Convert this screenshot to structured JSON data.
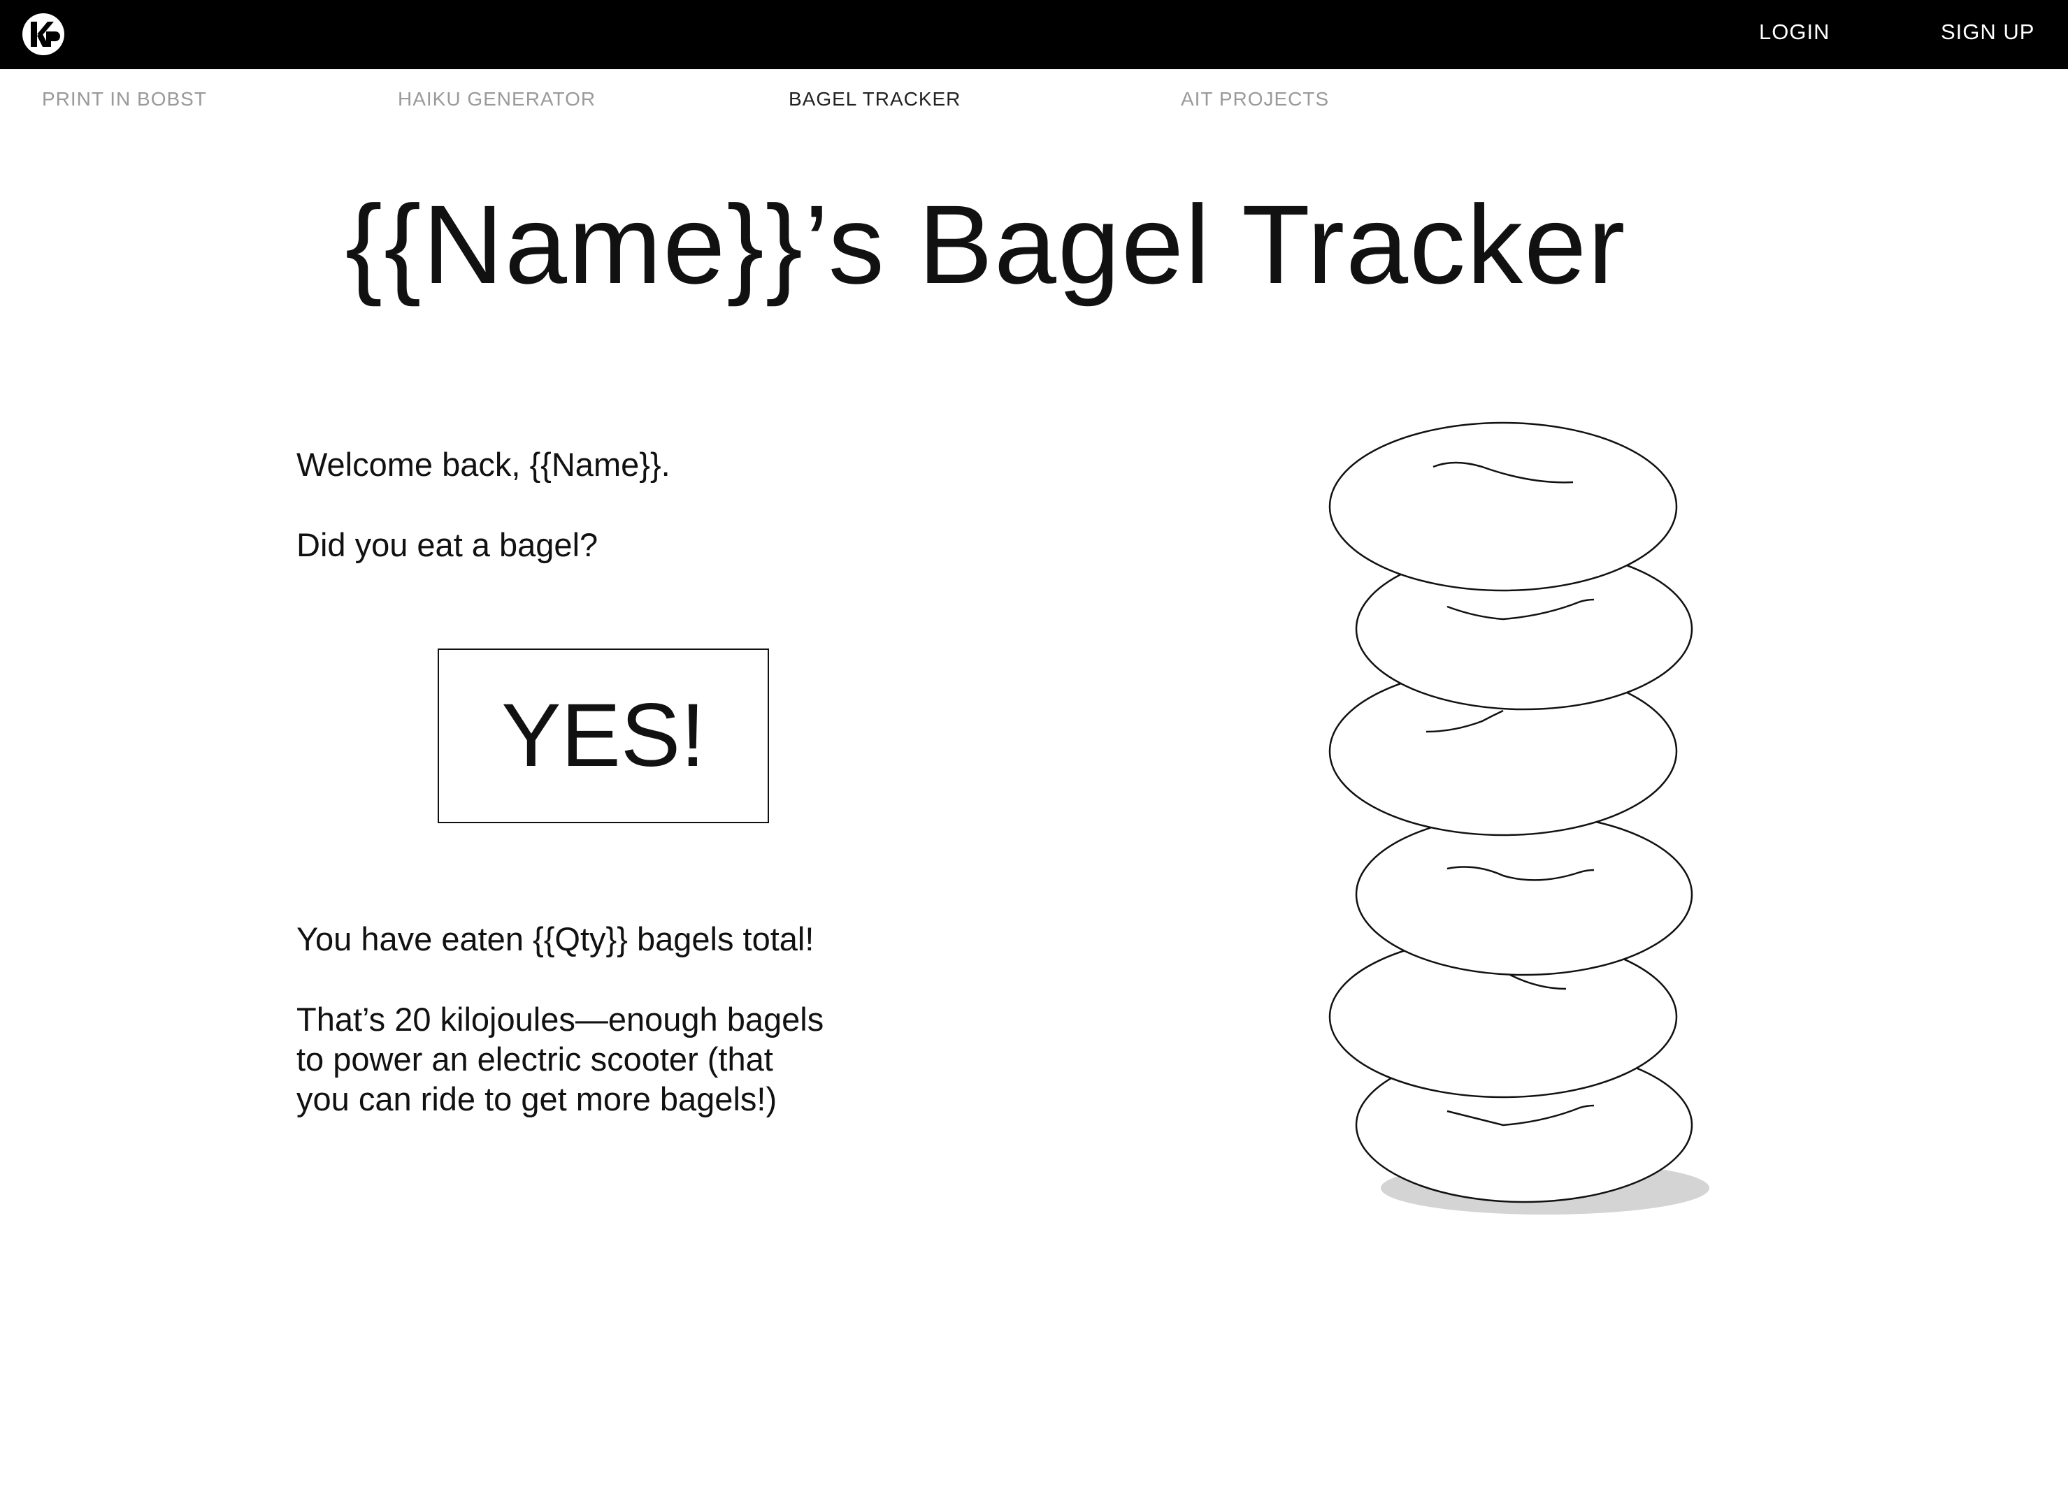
{
  "header": {
    "logo_icon": "kp-logo-icon",
    "login_label": "LOGIN",
    "signup_label": "SIGN UP"
  },
  "nav": {
    "items": [
      {
        "label": "PRINT IN BOBST",
        "active": false
      },
      {
        "label": "HAIKU GENERATOR",
        "active": false
      },
      {
        "label": "BAGEL TRACKER",
        "active": true
      },
      {
        "label": "AIT PROJECTS",
        "active": false
      }
    ]
  },
  "main": {
    "title": "{{Name}}’s Bagel Tracker",
    "welcome": "Welcome back, {{Name}}.",
    "question": "Did you eat a bagel?",
    "yes_button": "YES!",
    "total_text": "You have eaten {{Qty}} bagels total!",
    "energy_line1": "That’s 20 kilojoules—enough bagels",
    "energy_line2": "to power an electric scooter (that",
    "energy_line3": "you can ride to get more bagels!)"
  },
  "illustration": {
    "name": "bagel-stack-illustration",
    "bagel_count": 6
  },
  "colors": {
    "topbar": "#000000",
    "nav_inactive": "#9a9a9a",
    "nav_active": "#222222",
    "shadow": "#d4d4d4"
  }
}
